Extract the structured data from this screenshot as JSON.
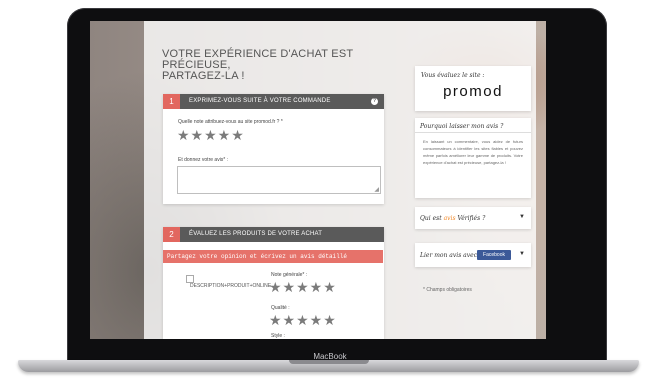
{
  "device": {
    "brand_label": "MacBook"
  },
  "page": {
    "title_line1": "VOTRE EXPÉRIENCE D'ACHAT EST PRÉCIEUSE,",
    "title_line2": "PARTAGEZ-LA !"
  },
  "section1": {
    "number": "1",
    "title": "EXPRIMEZ-VOUS SUITE À VOTRE COMMANDE",
    "help_glyph": "?",
    "rating_label": "Quelle note attribuez-vous au site promod.fr ? *",
    "rating_stars": "★★★★★",
    "review_label": "Et donnez votre avis* :",
    "review_value": ""
  },
  "section2": {
    "number": "2",
    "title": "ÉVALUEZ LES PRODUITS DE VOTRE ACHAT",
    "banner": "Partagez votre opinion et écrivez un avis détaillé",
    "product_image_alt": "DESCRIPTION+PRODUIT+ONLINE",
    "overall_label": "Note générale* :",
    "overall_stars": "★★★★★",
    "quality_label": "Qualité :",
    "quality_stars": "★★★★★",
    "style_label": "Style :"
  },
  "sidebar": {
    "rating_title": "Vous évaluez le site :",
    "brand_logo": "promod",
    "why_title": "Pourquoi laisser mon avis ?",
    "why_body": "En laissant un commentaire, vous aidez de futurs consommateurs à identifier les sites fiables et pouvez même parfois améliorer leur gamme de produits. Votre expérience d'achat est précieuse, partagez-la !",
    "who_prefix": "Qui est ",
    "who_highlight": "avis",
    "who_suffix": " Vérifiés ?",
    "share_label": "Lier mon avis avec",
    "facebook_label": "Facebook",
    "mandatory_note": "* Champs obligatoires"
  },
  "icons": {
    "chevron": "chevron-down-icon",
    "help": "help-icon",
    "resize": "resize-grip-icon"
  },
  "colors": {
    "section_number": "#e2675f",
    "section_head": "#5a5a5a",
    "banner": "#e6726a",
    "facebook": "#3b5998",
    "highlight": "#f08a2c"
  }
}
